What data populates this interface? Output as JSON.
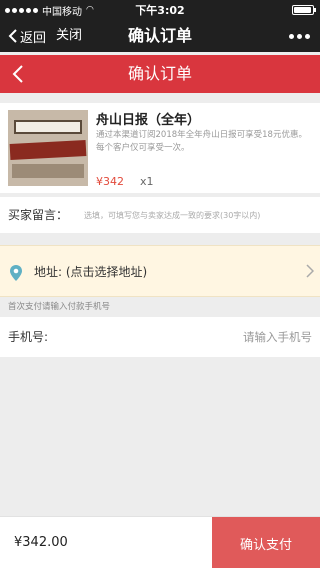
{
  "status_bar": {
    "carrier": "中国移动",
    "time": "下午3:02",
    "battery_level": 0.95
  },
  "wechat_nav": {
    "back_label": "返回",
    "close_label": "关闭",
    "title": "确认订单",
    "more_icon": "more-dots-icon"
  },
  "header": {
    "back_icon": "chevron-left-icon",
    "title": "确认订单"
  },
  "product": {
    "name": "舟山日报（全年）",
    "description": "通过本渠道订阅2018年全年舟山日报可享受18元优惠。每个客户仅可享受一次。",
    "price": "¥342",
    "quantity": "x1"
  },
  "message": {
    "label": "买家留言：",
    "placeholder": "选填，可填写您与卖家达成一致的要求(30字以内)"
  },
  "address": {
    "icon": "location-pin-icon",
    "label": "地址: (点击选择地址)"
  },
  "pay_hint": "首次支付请输入付款手机号",
  "phone": {
    "label": "手机号:",
    "placeholder": "请输入手机号"
  },
  "footer": {
    "total": "¥342.00",
    "confirm_label": "确认支付"
  },
  "colors": {
    "header_red": "#d9363e",
    "confirm_button": "#e05a5a",
    "price_red": "#e24a3b",
    "address_bg": "#fff6e2",
    "pin_teal": "#5fb0c4"
  }
}
